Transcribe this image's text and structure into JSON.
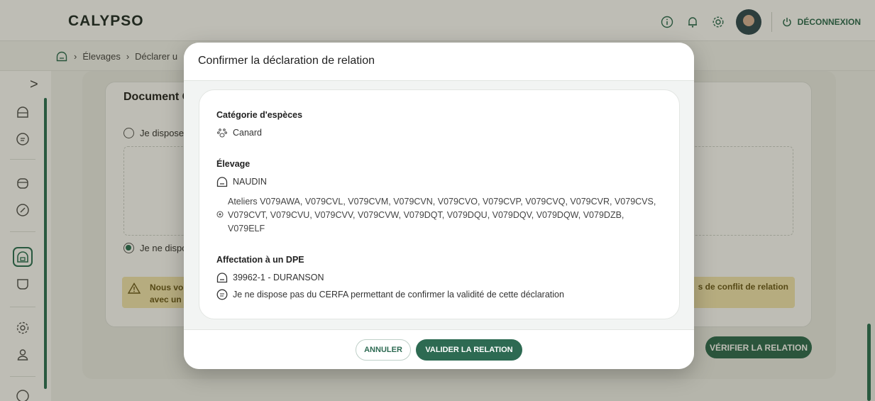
{
  "app": {
    "logo": "CALYPSO",
    "logout_label": "DÉCONNEXION"
  },
  "breadcrumb": {
    "items": [
      "Élevages",
      "Déclarer u"
    ]
  },
  "background": {
    "card_title": "Document C",
    "radio_1": "Je dispose",
    "radio_2": "Je ne dispo",
    "warning_left": "Nous vo\navec un",
    "warning_right": "s de conflit de relation",
    "verify_button": "VÉRIFIER LA RELATION"
  },
  "modal": {
    "title": "Confirmer la déclaration de relation",
    "species": {
      "label": "Catégorie d'espèces",
      "value": "Canard"
    },
    "elevage": {
      "label": "Élevage",
      "name": "NAUDIN",
      "ateliers": "Ateliers V079AWA, V079CVL, V079CVM, V079CVN, V079CVO, V079CVP, V079CVQ, V079CVR, V079CVS, V079CVT, V079CVU, V079CVV, V079CVW, V079DQT, V079DQU, V079DQV, V079DQW, V079DZB, V079ELF"
    },
    "dpe": {
      "label": "Affectation à un DPE",
      "value": "39962-1 - DURANSON",
      "cerfa_note": "Je ne dispose pas du CERFA permettant de confirmer la validité de cette déclaration"
    },
    "cancel_label": "ANNULER",
    "validate_label": "VALIDER LA RELATION"
  },
  "colors": {
    "primary": "#2d6a52",
    "warning_bg": "#f4e7b2"
  },
  "icons": [
    "info-icon",
    "bell-icon",
    "gear-icon",
    "logout-icon",
    "home-icon",
    "paw-icon",
    "document-icon",
    "atelier-icon"
  ]
}
